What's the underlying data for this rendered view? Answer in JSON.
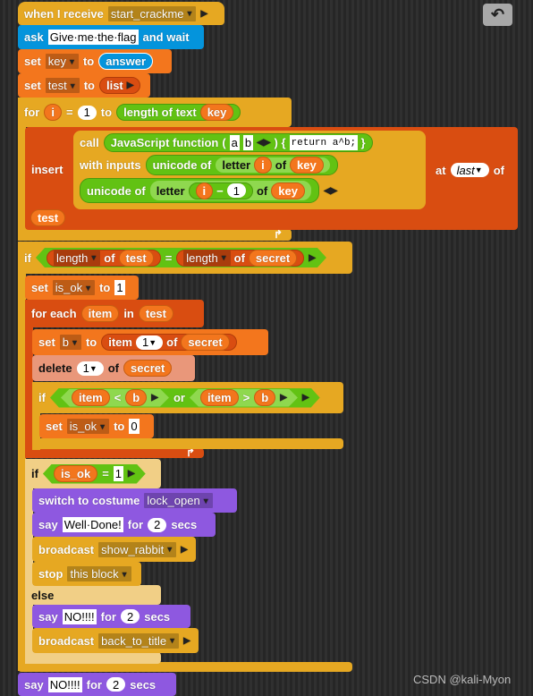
{
  "colors": {
    "control": "#e6a822",
    "sensing": "#0494dc",
    "variables": "#f3761d",
    "lists": "#d94d11",
    "looks": "#8e58e0",
    "operators": "#62c213"
  },
  "undo": {
    "icon": "undo-arrow-icon"
  },
  "hat": {
    "label": "when I receive",
    "message": "start_crackme"
  },
  "ask": {
    "label": "ask",
    "question": "Give·me·the·flag",
    "suffix": "and wait"
  },
  "set_key": {
    "set": "set",
    "var": "key",
    "to": "to",
    "value": "answer"
  },
  "set_test": {
    "set": "set",
    "var": "test",
    "to": "to",
    "value": "list"
  },
  "for": {
    "label": "for",
    "var": "i",
    "eq": "=",
    "start": "1",
    "to": "to",
    "end_label": "length of text",
    "end_arg": "key"
  },
  "insert": {
    "label": "insert",
    "call": "call",
    "js": "JavaScript function",
    "paren_open": "(",
    "arg_a": "a",
    "arg_b": "b",
    "paren_close": ") {",
    "code": "return a^b;",
    "brace": "}",
    "with_inputs": "with inputs",
    "unicode_of": "unicode of",
    "letter": "letter",
    "i": "i",
    "of": "of",
    "key": "key",
    "minus": "−",
    "one": "1",
    "at": "at",
    "position": "last",
    "of2": "of",
    "list": "test"
  },
  "if1": {
    "label": "if",
    "len1": "length",
    "of": "of",
    "test": "test",
    "eq": "=",
    "len2": "length",
    "secret": "secret"
  },
  "set_isok1": {
    "set": "set",
    "var": "is_ok",
    "to": "to",
    "value": "1"
  },
  "foreach": {
    "label": "for each",
    "var": "item",
    "in": "in",
    "list": "test"
  },
  "set_b": {
    "set": "set",
    "var": "b",
    "to": "to",
    "item": "item",
    "index": "1",
    "of": "of",
    "list": "secret"
  },
  "delete": {
    "label": "delete",
    "index": "1",
    "of": "of",
    "list": "secret"
  },
  "if2": {
    "label": "if",
    "item": "item",
    "lt": "<",
    "b": "b",
    "or": "or",
    "gt": ">"
  },
  "set_isok0": {
    "set": "set",
    "var": "is_ok",
    "to": "to",
    "value": "0"
  },
  "if3": {
    "label": "if",
    "var": "is_ok",
    "eq": "=",
    "value": "1",
    "else": "else"
  },
  "costume": {
    "label": "switch to costume",
    "value": "lock_open"
  },
  "say1": {
    "say": "say",
    "msg": "Well·Done!",
    "for": "for",
    "secs": "2",
    "unit": "secs"
  },
  "bc1": {
    "label": "broadcast",
    "msg": "show_rabbit"
  },
  "stop": {
    "label": "stop",
    "option": "this block"
  },
  "say2": {
    "say": "say",
    "msg": "NO!!!!",
    "for": "for",
    "secs": "2",
    "unit": "secs"
  },
  "bc2": {
    "label": "broadcast",
    "msg": "back_to_title"
  },
  "say3": {
    "say": "say",
    "msg": "NO!!!!",
    "for": "for",
    "secs": "2",
    "unit": "secs"
  },
  "watermark": "CSDN @kali-Myon"
}
